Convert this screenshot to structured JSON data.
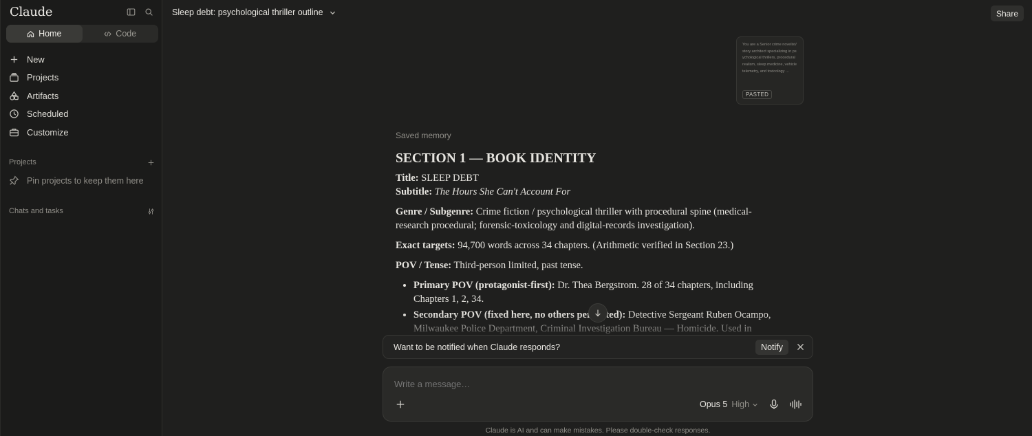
{
  "sidebar": {
    "brand": "Claude",
    "modes": [
      {
        "label": "Home",
        "icon": "home-icon",
        "active": true
      },
      {
        "label": "Code",
        "icon": "code-icon",
        "active": false
      }
    ],
    "nav": [
      {
        "label": "New",
        "icon": "plus-icon"
      },
      {
        "label": "Projects",
        "icon": "projects-icon"
      },
      {
        "label": "Artifacts",
        "icon": "artifacts-icon"
      },
      {
        "label": "Scheduled",
        "icon": "clock-icon"
      },
      {
        "label": "Customize",
        "icon": "briefcase-icon"
      }
    ],
    "projects_heading": "Projects",
    "pin_hint": "Pin projects to keep them here",
    "chats_heading": "Chats and tasks"
  },
  "header": {
    "title": "Sleep debt: psychological thriller outline",
    "share_label": "Share"
  },
  "pasted": {
    "preview": "You are a Senior crime novelist/story architect specializing in psychological thrillers, procedural realism, sleep medicine, vehicle telemetry, and toxicology ...",
    "tag": "PASTED"
  },
  "message": {
    "saved_memory": "Saved memory",
    "heading": "SECTION 1 — BOOK IDENTITY",
    "title_label": "Title:",
    "title_value": "SLEEP DEBT",
    "subtitle_label": "Subtitle:",
    "subtitle_value": "The Hours She Can't Account For",
    "genre_label": "Genre / Subgenre:",
    "genre_value": "Crime fiction / psychological thriller with procedural spine (medical-research procedural; forensic-toxicology and digital-records investigation).",
    "targets_label": "Exact targets:",
    "targets_value": "94,700 words across 34 chapters. (Arithmetic verified in Section 23.)",
    "pov_label": "POV / Tense:",
    "pov_value": "Third-person limited, past tense.",
    "bullets": [
      {
        "label": "Primary POV (protagonist-first):",
        "value": "Dr. Thea Bergstrom. 28 of 34 chapters, including Chapters 1, 2, 34."
      },
      {
        "label": "Secondary POV (fixed here, no others permitted):",
        "value": "Detective Sergeant Ruben Ocampo, Milwaukee Police Department, Criminal Investigation Bureau — Homicide. Used in"
      }
    ]
  },
  "notify": {
    "text": "Want to be notified when Claude responds?",
    "button": "Notify"
  },
  "composer": {
    "placeholder": "Write a message…",
    "model": "Opus 5",
    "effort": "High"
  },
  "disclaimer": "Claude is AI and can make mistakes. Please double-check responses."
}
